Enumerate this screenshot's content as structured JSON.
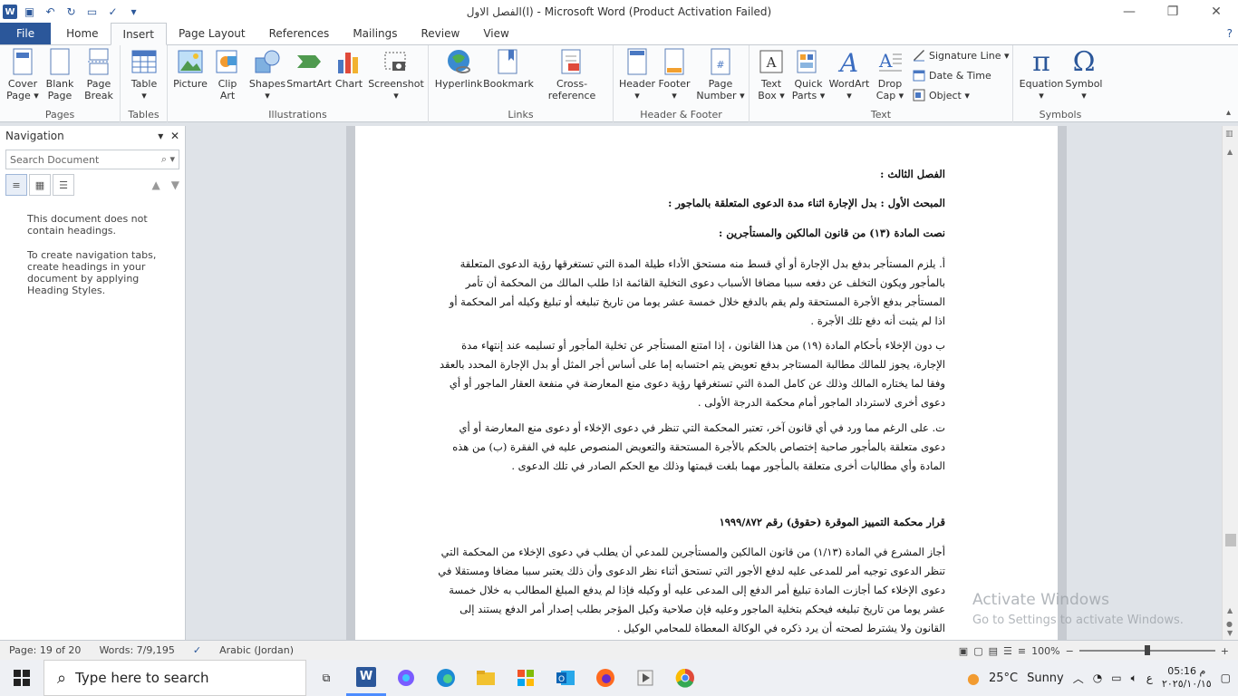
{
  "window": {
    "title": "الفصل الاول(I)  -  Microsoft Word (Product Activation Failed)"
  },
  "tabs": [
    "File",
    "Home",
    "Insert",
    "Page Layout",
    "References",
    "Mailings",
    "Review",
    "View"
  ],
  "ribbon": {
    "pages": {
      "label": "Pages",
      "cover": "Cover\nPage ▾",
      "blank": "Blank\nPage",
      "break": "Page\nBreak"
    },
    "tables": {
      "label": "Tables",
      "table": "Table\n▾"
    },
    "illustrations": {
      "label": "Illustrations",
      "picture": "Picture",
      "clipart": "Clip\nArt",
      "shapes": "Shapes\n▾",
      "smartart": "SmartArt",
      "chart": "Chart",
      "screenshot": "Screenshot\n▾"
    },
    "links": {
      "label": "Links",
      "hyperlink": "Hyperlink",
      "bookmark": "Bookmark",
      "crossref": "Cross-reference"
    },
    "hf": {
      "label": "Header & Footer",
      "header": "Header\n▾",
      "footer": "Footer\n▾",
      "pagenumber": "Page\nNumber ▾"
    },
    "text": {
      "label": "Text",
      "textbox": "Text\nBox ▾",
      "quickparts": "Quick\nParts ▾",
      "wordart": "WordArt\n▾",
      "dropcap": "Drop\nCap ▾",
      "signature": "Signature Line ▾",
      "datetime": "Date & Time",
      "object": "Object ▾"
    },
    "symbols": {
      "label": "Symbols",
      "equation": "Equation\n▾",
      "symbol": "Symbol\n▾"
    }
  },
  "nav": {
    "title": "Navigation",
    "search_placeholder": "Search Document",
    "msg1": "This document does not contain headings.",
    "msg2": "To create navigation tabs, create headings in your document by applying Heading Styles."
  },
  "doc": {
    "h1": "الفصل الثالث :",
    "h2": "المبحث الأول : بدل الإجارة اثناء مدة الدعوى المتعلقة بالماجور :",
    "h3": "نصت المادة (١٣) من قانون المالكين والمستأجرين :",
    "p1": "أ. يلزم المستأجر بدفع بدل الإجارة أو أي قسط منه مستحق الأداء طيلة المدة التي تستغرقها رؤية الدعوى المتعلقة بالمأجور ويكون التخلف عن دفعه سببا مضافا الأسباب دعوى التخلية القائمة اذا طلب المالك من المحكمة أن تأمر المستأجر بدفع الأجرة المستحقة ولم يقم بالدفع خلال خمسة عشر يوما من تاريخ تبليغه أو تبليغ وكيله أمر المحكمة أو اذا لم يثبت أنه دفع تلك الأجرة .",
    "p2": "ب دون الإخلاء بأحكام المادة (١٩) من هذا القانون ، إذا امتنع المستأجر عن تخلية المأجور أو تسليمه عند إنتهاء مدة الإجارة، يجوز للمالك مطالبة المستاجر بدفع تعويض يتم احتسابه إما على أساس أجر المثل أو بدل الإجارة المحدد بالعقد وفقا لما يختاره المالك وذلك عن كامل المدة التي تستغرقها رؤية دعوى منع المعارضة في منفعة العقار الماجور أو أي دعوى أخرى لاسترداد الماجور أمام محكمة الدرجة الأولى .",
    "p3": "ت. على الرغم مما ورد في أي قانون آخر، تعتبر المحكمة التي تنظر في دعوى الإخلاء أو دعوى منع المعارضة أو أي دعوى متعلقة بالمأجور صاحبة إختصاص بالحكم بالأجرة المستحقة والتعويض المنصوص عليه في الفقرة (ب) من هذه المادة وأي مطالبات أخرى متعلقة بالمأجور مهما بلغت قيمتها وذلك مع الحكم الصادر في تلك الدعوى .",
    "h4": "قرار محكمة التمييز الموقرة (حقوق) رقم ١٩٩٩/٨٧٢",
    "p4": "أجاز المشرع في المادة (١/١٣) من قانون المالكين والمستأجرين للمدعي أن يطلب في دعوى الإخلاء من المحكمة التي تنظر الدعوى توجيه أمر للمدعى عليه لدفع الأجور التي تستحق أثناء نظر الدعوى وأن ذلك يعتبر سببا مضافا ومستقلا في دعوى الإخلاء كما أجازت المادة تبليغ أمر الدفع إلى المدعى عليه أو وكيله فإذا لم يدفع المبلغ المطالب به خلال خمسة عشر يوما من تاريخ تبليغه فيحكم بتخلية الماجور وعليه فإن صلاحية وكيل المؤجر بطلب إصدار أمر الدفع يستند إلى القانون ولا يشترط لصحته أن يرد ذكره في الوكالة المعطاة للمحامي الوكيل ."
  },
  "watermark": {
    "line1": "Activate Windows",
    "line2": "Go to Settings to activate Windows."
  },
  "status": {
    "page": "Page: 19 of 20",
    "words": "Words: 7/9,195",
    "lang": "Arabic (Jordan)",
    "zoom": "100%"
  },
  "taskbar": {
    "search": "Type here to search",
    "weather_temp": "25°C",
    "weather_desc": "Sunny",
    "lang": "ع",
    "time": "05:16 م",
    "date": "٢٠٢٥/١٠/١٥"
  }
}
